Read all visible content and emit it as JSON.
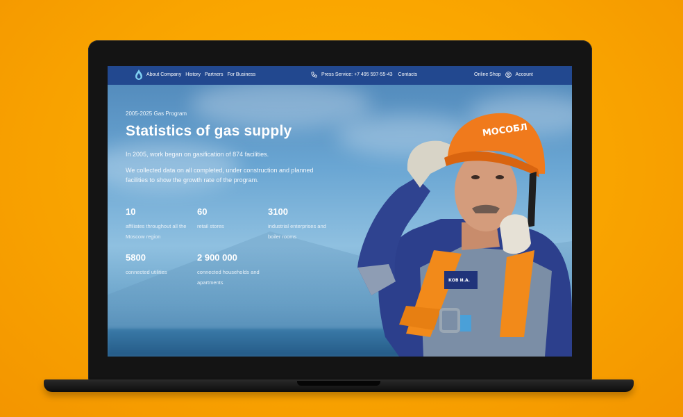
{
  "nav": {
    "items": [
      "About Company",
      "History",
      "Partners",
      "For Business"
    ],
    "press_service": "Press Service: +7 495 597-55-43",
    "contacts": "Contacts",
    "online_shop": "Online Shop",
    "account": "Account"
  },
  "hero": {
    "eyebrow": "2005-2025 Gas Program",
    "title": "Statistics of gas supply",
    "intro": "In 2005, work began on gasification of 874 facilities.",
    "description": "We collected data on all completed, under construction and planned facilities to show the growth rate of the program."
  },
  "stats": [
    {
      "value": "10",
      "label": "affiliates throughout all the Moscow region"
    },
    {
      "value": "60",
      "label": "retail stores"
    },
    {
      "value": "3100",
      "label": "industrial enterprises and boiler rooms"
    },
    {
      "value": "5800",
      "label": "connected utilities"
    },
    {
      "value": "2 900 000",
      "label": "connected households and apartments"
    }
  ],
  "photo": {
    "helmet_text": "МОСОБЛ",
    "badge_text": "КОВ И.А."
  },
  "colors": {
    "background": "#f9a400",
    "nav": "#22488f",
    "helmet": "#f07a1c",
    "uniform": "#2c3f8c"
  }
}
